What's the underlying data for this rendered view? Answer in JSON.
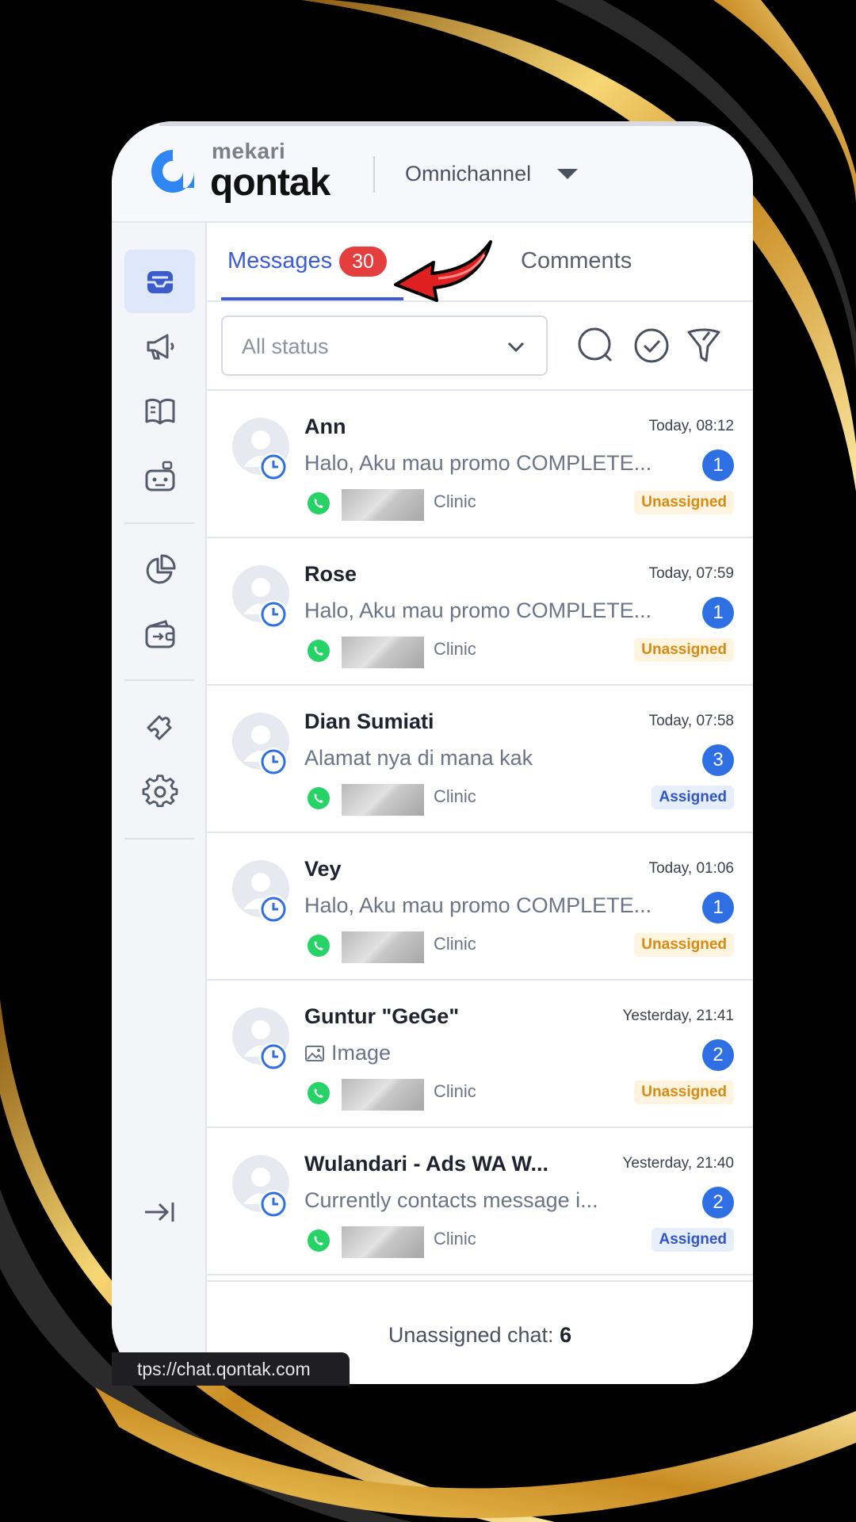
{
  "colors": {
    "accent": "#3b5bdb",
    "badge_red": "#e53e3e",
    "count_blue": "#2f6fe4",
    "unassigned": "#d98a10",
    "assigned": "#2f55c8",
    "whatsapp": "#25d366",
    "gold": "#e8b84a"
  },
  "header": {
    "logo_small": "mekari",
    "logo_big": "qontak",
    "product": "Omnichannel"
  },
  "sidebar": {
    "items": [
      {
        "icon": "inbox-icon",
        "active": true
      },
      {
        "icon": "megaphone-icon"
      },
      {
        "icon": "book-icon"
      },
      {
        "icon": "robot-icon"
      },
      {
        "icon": "pie-chart-icon"
      },
      {
        "icon": "wallet-icon"
      },
      {
        "icon": "puzzle-icon"
      },
      {
        "icon": "gear-icon"
      }
    ],
    "collapse_icon": "collapse-arrow-icon"
  },
  "tabs": {
    "messages_label": "Messages",
    "messages_badge": "30",
    "comments_label": "Comments"
  },
  "filter": {
    "status_value": "All status",
    "icons": [
      "search-icon",
      "check-circle-icon",
      "filter-icon"
    ]
  },
  "messages": [
    {
      "name": "Ann",
      "time": "Today, 08:12",
      "preview": "Halo, Aku mau promo COMPLETE...",
      "count": "1",
      "channel": "Clinic",
      "status": "Unassigned"
    },
    {
      "name": "Rose",
      "time": "Today, 07:59",
      "preview": "Halo, Aku mau promo COMPLETE...",
      "count": "1",
      "channel": "Clinic",
      "status": "Unassigned"
    },
    {
      "name": "Dian Sumiati",
      "time": "Today, 07:58",
      "preview": "Alamat nya di mana kak",
      "count": "3",
      "channel": "Clinic",
      "status": "Assigned"
    },
    {
      "name": "Vey",
      "time": "Today, 01:06",
      "preview": "Halo, Aku mau promo COMPLETE...",
      "count": "1",
      "channel": "Clinic",
      "status": "Unassigned"
    },
    {
      "name": "Guntur \"GeGe\"",
      "time": "Yesterday, 21:41",
      "preview": "Image",
      "count": "2",
      "channel": "Clinic",
      "status": "Unassigned"
    },
    {
      "name": "Wulandari - Ads WA W...",
      "time": "Yesterday, 21:40",
      "preview": "Currently contacts message i...",
      "count": "2",
      "channel": "Clinic",
      "status": "Assigned"
    }
  ],
  "footer": {
    "label": "Unassigned chat:",
    "value": "6"
  },
  "url_tooltip": "tps://chat.qontak.com"
}
